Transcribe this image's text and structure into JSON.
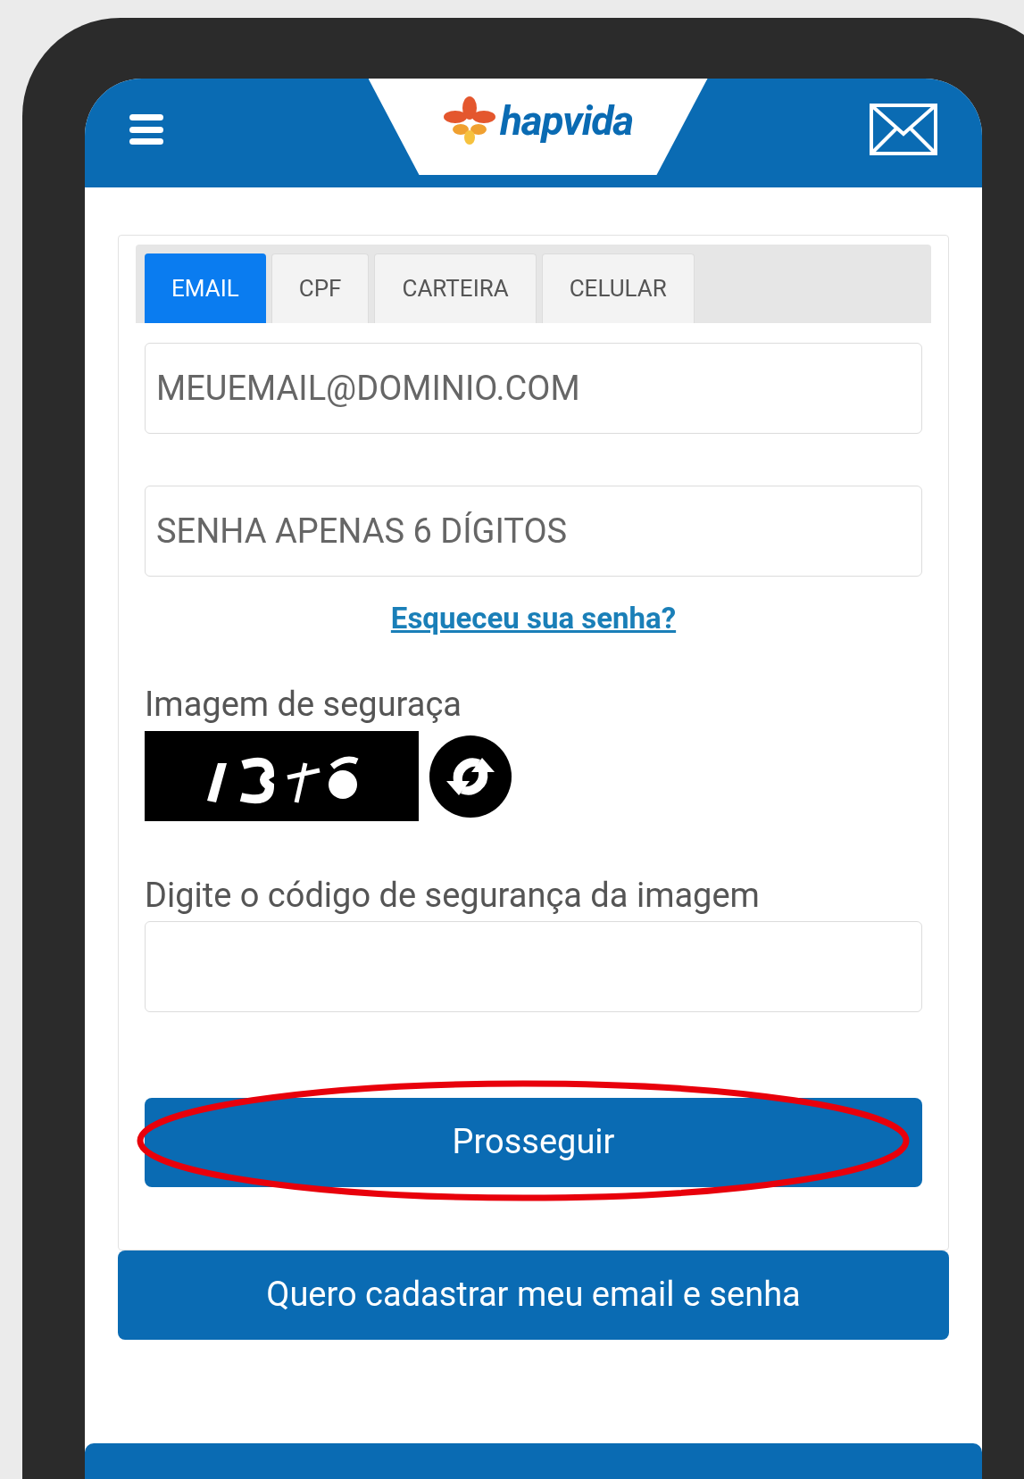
{
  "header": {
    "logo_text": "hapvida"
  },
  "tabs": [
    {
      "label": "EMAIL",
      "selected": true
    },
    {
      "label": "CPF",
      "selected": false
    },
    {
      "label": "CARTEIRA",
      "selected": false
    },
    {
      "label": "CELULAR",
      "selected": false
    }
  ],
  "login_field": {
    "placeholder": "MEUEMAIL@DOMINIO.COM"
  },
  "password_field": {
    "placeholder": "SENHA APENAS 6 DÍGITOS"
  },
  "forgot_link": "Esqueceu sua senha?",
  "captcha": {
    "label": "Imagem de seguraça",
    "kind": "picture"
  },
  "code_field": {
    "label": "Digite o código de segurança da imagem"
  },
  "submit_button": {
    "label": "Prosseguir",
    "highlighted": true
  },
  "register_button": {
    "label": "Quero cadastrar meu email e senha"
  }
}
